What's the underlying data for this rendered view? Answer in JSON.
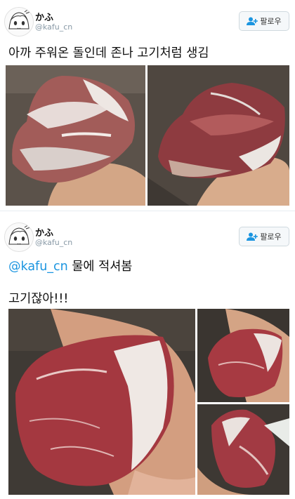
{
  "tweets": [
    {
      "author_name": "かふ",
      "author_handle": "@kafu_cn",
      "follow_label": "팔로우",
      "text": "아까 주워온 돌인데 존나 고기처럼 생김",
      "photos": [
        "rock-photo-1",
        "rock-photo-2"
      ]
    },
    {
      "author_name": "かふ",
      "author_handle": "@kafu_cn",
      "follow_label": "팔로우",
      "mention": "@kafu_cn",
      "text_after_mention": " 물에 적셔봄",
      "text_line2": "고기잖아!!!",
      "photos": [
        "wet-rock-photo-1",
        "wet-rock-photo-2",
        "wet-rock-photo-3"
      ]
    }
  ],
  "colors": {
    "mention": "#1b95e0",
    "follow_icon": "#1b95e0",
    "rock_red": "#9c3a3e",
    "rock_white": "#e8e4e0"
  },
  "icons": [
    "avatar-anime-girl",
    "add-user-icon"
  ]
}
